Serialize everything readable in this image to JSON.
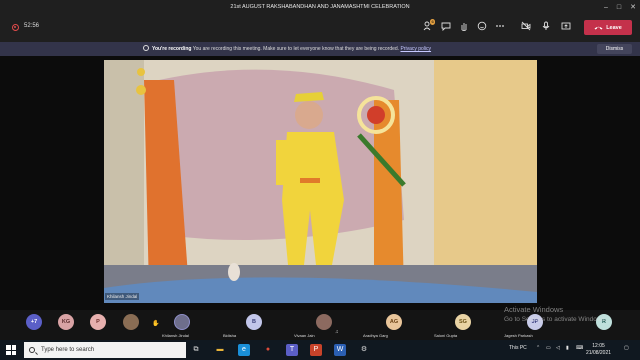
{
  "window": {
    "title": "21st AUGUST RAKSHABANDHAN AND JANAMASHTMI CELEBRATION",
    "controls": [
      "–",
      "□",
      "✕"
    ]
  },
  "toolbar": {
    "timer": "52:56",
    "participant_count": "6",
    "leave_label": "Leave",
    "icons": [
      "people-icon",
      "chat-icon",
      "raise-hand-icon",
      "reactions-icon",
      "more-icon",
      "camera-icon",
      "mic-icon",
      "share-icon"
    ]
  },
  "banner": {
    "headline": "You're recording",
    "message": "You are recording this meeting. Make sure to let everyone know that they are being recorded.",
    "link": "Privacy policy",
    "dismiss_label": "Dismiss"
  },
  "video": {
    "name": "Khilansh Jindal"
  },
  "roster": {
    "overflow": "+7",
    "participants": [
      {
        "initials": "KG",
        "name": "",
        "color": "#d9a3a5",
        "fg": "#5c2c2e"
      },
      {
        "initials": "P",
        "name": "",
        "color": "#e7b0ae",
        "fg": "#6b2b28"
      },
      {
        "initials": "",
        "name": "",
        "color": "#8a6d54",
        "fg": "#fff",
        "photo": true
      },
      {
        "initials": "",
        "name": "Khilansh Jindal",
        "color": "#6e6e8c",
        "fg": "#fff",
        "photo": true,
        "hand": true
      },
      {
        "initials": "B",
        "name": "Bidisha",
        "color": "#c2c6ea",
        "fg": "#3a3f7a"
      },
      {
        "initials": "",
        "name": "Vivaan Jain",
        "color": "#8c6a60",
        "fg": "#fff",
        "photo": true
      },
      {
        "initials": "AG",
        "name": "Aradhya Garg",
        "color": "#e9c59a",
        "fg": "#6b4215"
      },
      {
        "initials": "SG",
        "name": "Saloni Gupta",
        "color": "#e9d3a4",
        "fg": "#6b5217"
      },
      {
        "initials": "JP",
        "name": "Jagesh Parkash",
        "color": "#c8cbe9",
        "fg": "#3c4180"
      },
      {
        "initials": "R",
        "name": "",
        "color": "#bfe0dc",
        "fg": "#1f5a54"
      }
    ]
  },
  "watermark": {
    "line1": "Activate Windows",
    "line2": "Go to Settings to activate Windows."
  },
  "taskbar": {
    "search_placeholder": "Type here to search",
    "tray_label": "This PC",
    "time": "12:05",
    "date": "21/08/2021",
    "apps": [
      {
        "name": "task-view-icon",
        "glyph": "⧉",
        "color": "transparent"
      },
      {
        "name": "file-explorer-icon",
        "glyph": "▬",
        "color": "#e8b339"
      },
      {
        "name": "edge-icon",
        "glyph": "e",
        "color": "#1a8fd8"
      },
      {
        "name": "chrome-icon",
        "glyph": "●",
        "color": "#dd4b39"
      },
      {
        "name": "teams-icon",
        "glyph": "T",
        "color": "#5b5fc7"
      },
      {
        "name": "powerpoint-icon",
        "glyph": "P",
        "color": "#c8432a"
      },
      {
        "name": "word-icon",
        "glyph": "W",
        "color": "#2b5fb3"
      },
      {
        "name": "settings-icon",
        "glyph": "⚙",
        "color": "transparent"
      }
    ]
  }
}
